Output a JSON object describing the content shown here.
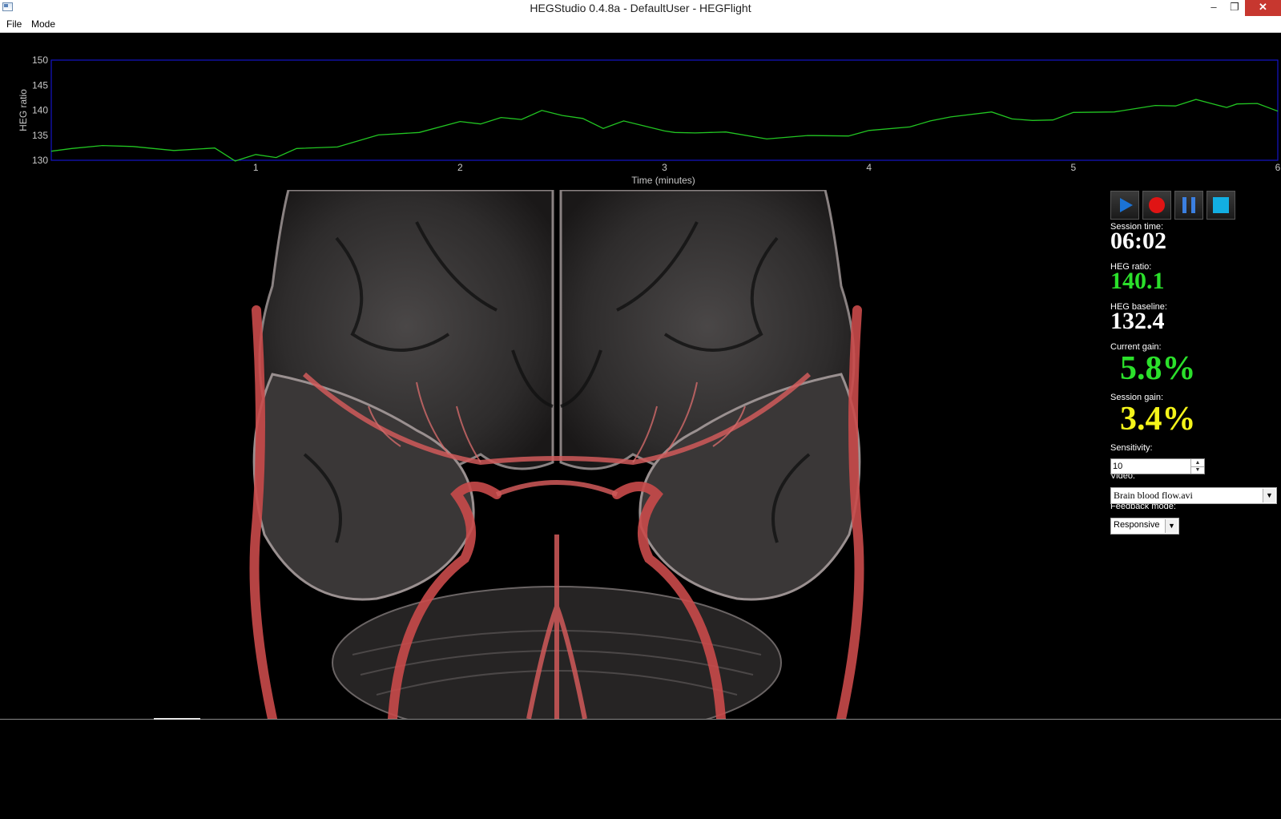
{
  "window": {
    "title": "HEGStudio 0.4.8a - DefaultUser - HEGFlight",
    "minimize_glyph": "–",
    "maximize_glyph": "❐",
    "close_glyph": "✕"
  },
  "menu": {
    "items": [
      "File",
      "Mode"
    ]
  },
  "chart_data": {
    "type": "line",
    "title": "",
    "xlabel": "Time (minutes)",
    "ylabel": "HEG ratio",
    "xlim": [
      0,
      6
    ],
    "ylim": [
      130,
      150
    ],
    "xticks": [
      "1",
      "2",
      "3",
      "4",
      "5",
      "6"
    ],
    "yticks": [
      "150",
      "145",
      "140",
      "135",
      "130"
    ],
    "grid": false,
    "colors": {
      "line": "#22c622",
      "frame": "#1414c8",
      "text": "#c8c8c8"
    },
    "series": [
      {
        "x": [
          0,
          0.1,
          0.25,
          0.4,
          0.6,
          0.8,
          0.9,
          1.0,
          1.1,
          1.2,
          1.4,
          1.6,
          1.8,
          2.0,
          2.1,
          2.2,
          2.3,
          2.4,
          2.5,
          2.6,
          2.7,
          2.8,
          3.0,
          3.05,
          3.15,
          3.3,
          3.5,
          3.7,
          3.9,
          4.0,
          4.2,
          4.3,
          4.4,
          4.6,
          4.7,
          4.8,
          4.9,
          5.0,
          5.2,
          5.4,
          5.5,
          5.6,
          5.7,
          5.75,
          5.8,
          5.9,
          6.0
        ],
        "y": [
          131.8,
          132.0,
          133.3,
          132.4,
          132.3,
          132.1,
          130.2,
          130.8,
          130.9,
          132.0,
          133.0,
          134.7,
          135.9,
          137.4,
          137.6,
          138.2,
          138.5,
          139.6,
          139.3,
          138.0,
          136.7,
          137.5,
          136.2,
          135.2,
          135.8,
          135.3,
          134.6,
          134.6,
          135.2,
          135.6,
          137.0,
          137.5,
          139.0,
          139.3,
          138.6,
          137.6,
          138.4,
          139.2,
          140.0,
          140.6,
          141.2,
          141.8,
          141.4,
          140.2,
          141.6,
          141.0,
          139.8
        ]
      }
    ]
  },
  "controls": {
    "buttons": [
      "play",
      "record",
      "pause",
      "stop"
    ],
    "colors": {
      "play": "#1b73d6",
      "record": "#e01414",
      "pause": "#3b7fe0",
      "stop": "#12aee2"
    }
  },
  "stats": {
    "session_time_label": "Session time:",
    "session_time": "06:02",
    "heg_ratio_label": "HEG ratio:",
    "heg_ratio": "140.1",
    "heg_baseline_label": "HEG baseline:",
    "heg_baseline": "132.4",
    "current_gain_label": "Current gain:",
    "current_gain": "5.8%",
    "session_gain_label": "Session gain:",
    "session_gain": "3.4%",
    "colors": {
      "white": "#ffffff",
      "green": "#2be02b",
      "yellow": "#f4f41a"
    }
  },
  "settings": {
    "sensitivity_label": "Sensitivity:",
    "sensitivity_value": "10",
    "video_label": "Video:",
    "video_value": "Brain blood flow.avi",
    "feedback_label": "Feedback mode:",
    "feedback_value": "Responsive"
  },
  "video": {
    "description_icon": "brain-video-frame"
  }
}
